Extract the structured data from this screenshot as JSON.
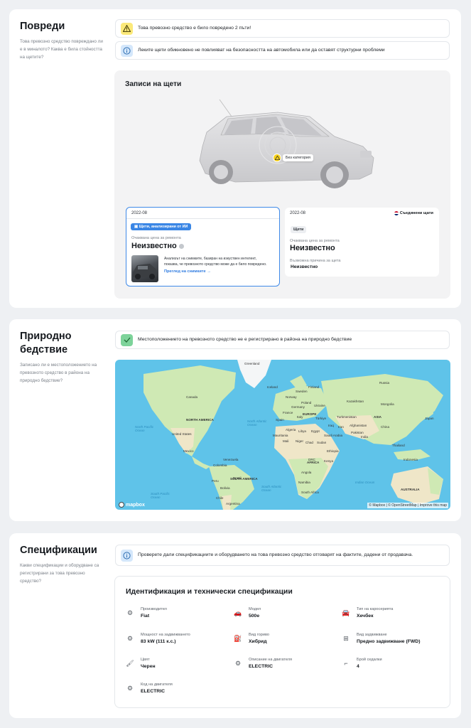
{
  "damage": {
    "title": "Повреди",
    "description": "Това превозно средство повреждано ли е в миналото? Каква е била стойността на щетите?",
    "notice_warning": "Това превозно средство е било повредено 2 пъти!",
    "notice_info": "Леките щети обикновено не повлияват на безопасността на автомобила или да оставят структурни проблеми",
    "records_title": "Записи на щети",
    "marker_label": "Без категория",
    "records": [
      {
        "date": "2022-08",
        "tag": "Щети, анализирани от ИИ",
        "cost_label": "Очаквана цена за ремонта",
        "cost_value": "Неизвестно",
        "analysis_text": "Анализът на снимките, базиран на изкуствен интелект, показва, че превозното средство може да е било повредено.",
        "link": "Преглед на снимките"
      },
      {
        "date": "2022-08",
        "source": "Съединени щати",
        "tag": "Щети",
        "cost_label": "Очаквана цена за ремонта",
        "cost_value": "Неизвестно",
        "cause_label": "Възможна причина за щета",
        "cause_value": "Неизвестно"
      }
    ]
  },
  "disaster": {
    "title": "Природно бедствие",
    "description": "Записано ли е местоположението на превозното средство в района на природно бедствие?",
    "notice_ok": "Местоположението на превозното средство не е регистрирано в района на природно бедствие",
    "map": {
      "logo": "mapbox",
      "attribution": "© Mapbox | © OpenStreetMap | Improve this map",
      "labels": [
        "Greenland",
        "NORTH AMERICA",
        "SOUTH AMERICA",
        "EUROPE",
        "AFRICA",
        "ASIA",
        "AUSTRALIA",
        "Canada",
        "United States",
        "Mexico",
        "Brazil",
        "Peru",
        "Bolivia",
        "Chile",
        "Argentina",
        "Colombia",
        "Venezuela",
        "Iceland",
        "Sweden",
        "Finland",
        "Norway",
        "Poland",
        "Ukraine",
        "Germany",
        "France",
        "Spain",
        "Italy",
        "Türkiye",
        "Iraq",
        "Iran",
        "Saudi Arabia",
        "Egypt",
        "Libya",
        "Algeria",
        "Mali",
        "Niger",
        "Chad",
        "Sudan",
        "Ethiopia",
        "Kenya",
        "DRC",
        "Angola",
        "Namibia",
        "South Africa",
        "Kazakhstan",
        "Mongolia",
        "China",
        "India",
        "Pakistan",
        "Afghanistan",
        "Turkmenistan",
        "Thailand",
        "Indonesia",
        "Japan",
        "Russia",
        "Mauritania"
      ],
      "seas": [
        "North Atlantic Ocean",
        "North Pacific Ocean",
        "South Atlantic Ocean",
        "South Pacific Ocean",
        "Indian Ocean"
      ],
      "colors": {
        "water": "#5fc3e9",
        "land": "#cfe9b4",
        "land_dry": "#efe6c8",
        "ice": "#f4f6f7"
      }
    }
  },
  "specs": {
    "title": "Спецификации",
    "description": "Какви спецификации и оборудване са регистрирани за това превозно средство?",
    "notice_info": "Проверете дали спецификациите и оборудването на това превозно средство отговарят на фактите, дадени от продавача.",
    "panel_title": "Идентификация и технически спецификации",
    "items": [
      {
        "label": "Производител",
        "value": "Fiat",
        "icon": "factory-icon"
      },
      {
        "label": "Модел",
        "value": "500e",
        "icon": "car-icon"
      },
      {
        "label": "Тип на каросерията",
        "value": "Хечбек",
        "icon": "car-body-icon"
      },
      {
        "label": "Мощност на задвижването",
        "value": "83 kW (111 к.с.)",
        "icon": "engine-icon"
      },
      {
        "label": "Вид гориво",
        "value": "Хибрид",
        "icon": "fuel-icon"
      },
      {
        "label": "Вид задвижване",
        "value": "Предно задвижване (FWD)",
        "icon": "drivetrain-icon"
      },
      {
        "label": "Цвят",
        "value": "Черен",
        "icon": "paint-roller-icon"
      },
      {
        "label": "Описание на двигателя",
        "value": "ELECTRIC",
        "icon": "gears-icon"
      },
      {
        "label": "Брой седалки",
        "value": "4",
        "icon": "seat-icon"
      },
      {
        "label": "Код на двигателя",
        "value": "ELECTRIC",
        "icon": "engine-code-icon"
      }
    ]
  },
  "colors": {
    "accent": "#3a86e5",
    "warning": "#fbe97a",
    "info": "#d4e7fb",
    "success": "#7dd39a"
  }
}
